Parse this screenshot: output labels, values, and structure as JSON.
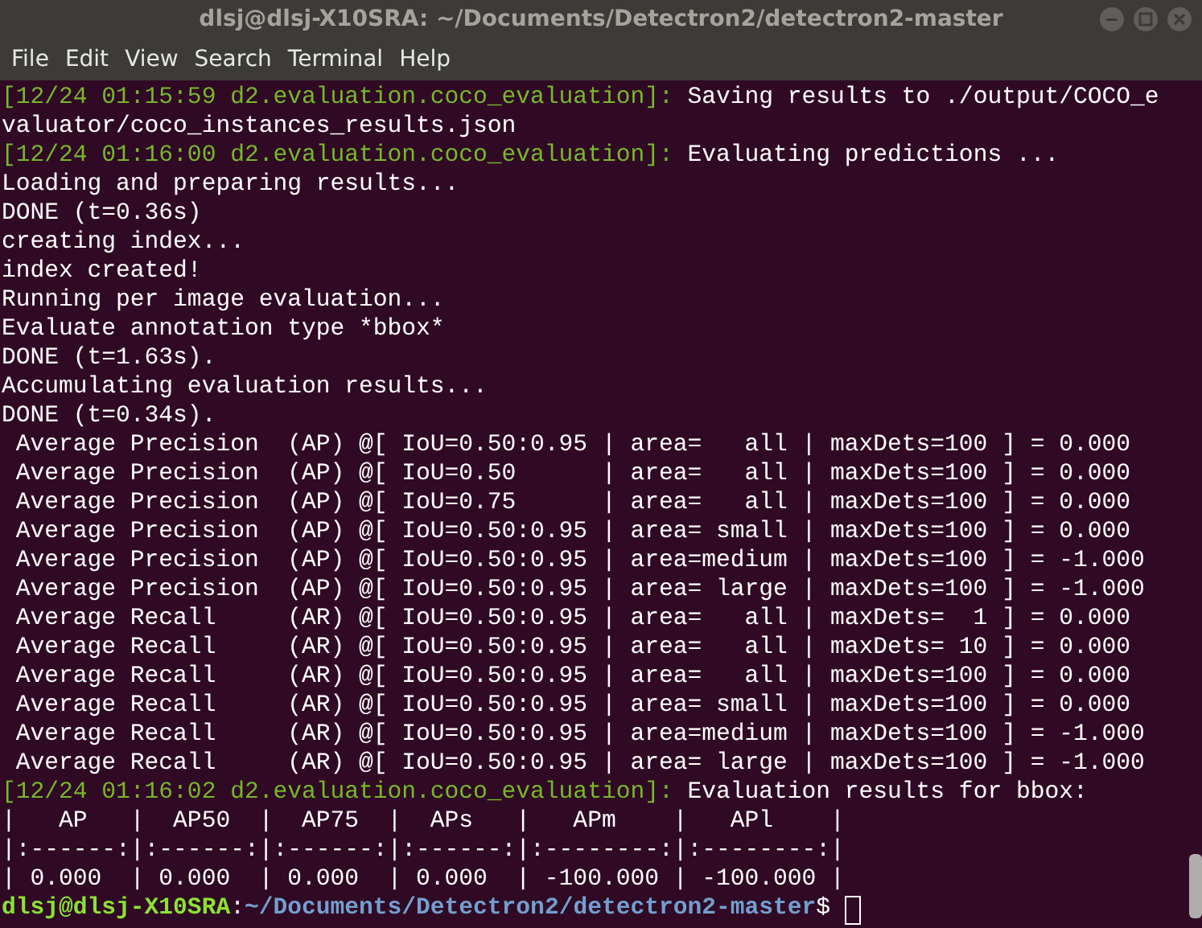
{
  "window": {
    "title": "dlsj@dlsj-X10SRA: ~/Documents/Detectron2/detectron2-master"
  },
  "menu": [
    "File",
    "Edit",
    "View",
    "Search",
    "Terminal",
    "Help"
  ],
  "terminal": {
    "lines": [
      [
        {
          "kind": "logger",
          "text": "[12/24 01:15:59 d2.evaluation.coco_evaluation]:"
        },
        {
          "kind": "output",
          "text": " Saving results to ./output/COCO_e"
        }
      ],
      [
        {
          "kind": "output",
          "text": "valuator/coco_instances_results.json"
        }
      ],
      [
        {
          "kind": "logger",
          "text": "[12/24 01:16:00 d2.evaluation.coco_evaluation]:"
        },
        {
          "kind": "output",
          "text": " Evaluating predictions ..."
        }
      ],
      [
        {
          "kind": "output",
          "text": "Loading and preparing results..."
        }
      ],
      [
        {
          "kind": "output",
          "text": "DONE (t=0.36s)"
        }
      ],
      [
        {
          "kind": "output",
          "text": "creating index..."
        }
      ],
      [
        {
          "kind": "output",
          "text": "index created!"
        }
      ],
      [
        {
          "kind": "output",
          "text": "Running per image evaluation..."
        }
      ],
      [
        {
          "kind": "output",
          "text": "Evaluate annotation type *bbox*"
        }
      ],
      [
        {
          "kind": "output",
          "text": "DONE (t=1.63s)."
        }
      ],
      [
        {
          "kind": "output",
          "text": "Accumulating evaluation results..."
        }
      ],
      [
        {
          "kind": "output",
          "text": "DONE (t=0.34s)."
        }
      ],
      [
        {
          "kind": "output",
          "text": " Average Precision  (AP) @[ IoU=0.50:0.95 | area=   all | maxDets=100 ] = 0.000"
        }
      ],
      [
        {
          "kind": "output",
          "text": " Average Precision  (AP) @[ IoU=0.50      | area=   all | maxDets=100 ] = 0.000"
        }
      ],
      [
        {
          "kind": "output",
          "text": " Average Precision  (AP) @[ IoU=0.75      | area=   all | maxDets=100 ] = 0.000"
        }
      ],
      [
        {
          "kind": "output",
          "text": " Average Precision  (AP) @[ IoU=0.50:0.95 | area= small | maxDets=100 ] = 0.000"
        }
      ],
      [
        {
          "kind": "output",
          "text": " Average Precision  (AP) @[ IoU=0.50:0.95 | area=medium | maxDets=100 ] = -1.000"
        }
      ],
      [
        {
          "kind": "output",
          "text": " Average Precision  (AP) @[ IoU=0.50:0.95 | area= large | maxDets=100 ] = -1.000"
        }
      ],
      [
        {
          "kind": "output",
          "text": " Average Recall     (AR) @[ IoU=0.50:0.95 | area=   all | maxDets=  1 ] = 0.000"
        }
      ],
      [
        {
          "kind": "output",
          "text": " Average Recall     (AR) @[ IoU=0.50:0.95 | area=   all | maxDets= 10 ] = 0.000"
        }
      ],
      [
        {
          "kind": "output",
          "text": " Average Recall     (AR) @[ IoU=0.50:0.95 | area=   all | maxDets=100 ] = 0.000"
        }
      ],
      [
        {
          "kind": "output",
          "text": " Average Recall     (AR) @[ IoU=0.50:0.95 | area= small | maxDets=100 ] = 0.000"
        }
      ],
      [
        {
          "kind": "output",
          "text": " Average Recall     (AR) @[ IoU=0.50:0.95 | area=medium | maxDets=100 ] = -1.000"
        }
      ],
      [
        {
          "kind": "output",
          "text": " Average Recall     (AR) @[ IoU=0.50:0.95 | area= large | maxDets=100 ] = -1.000"
        }
      ],
      [
        {
          "kind": "logger",
          "text": "[12/24 01:16:02 d2.evaluation.coco_evaluation]:"
        },
        {
          "kind": "output",
          "text": " Evaluation results for bbox:"
        }
      ],
      [
        {
          "kind": "output",
          "text": "|   AP   |  AP50  |  AP75  |  APs   |   APm    |   APl    |"
        }
      ],
      [
        {
          "kind": "output",
          "text": "|:------:|:------:|:------:|:------:|:--------:|:--------:|"
        }
      ],
      [
        {
          "kind": "output",
          "text": "| 0.000  | 0.000  | 0.000  | 0.000  | -100.000 | -100.000 |"
        }
      ],
      [
        {
          "kind": "user",
          "text": "dlsj@dlsj-X10SRA"
        },
        {
          "kind": "output",
          "text": ":"
        },
        {
          "kind": "path",
          "text": "~/Documents/Detectron2/detectron2-master"
        },
        {
          "kind": "output",
          "text": "$ "
        },
        {
          "kind": "cursor"
        }
      ]
    ]
  }
}
